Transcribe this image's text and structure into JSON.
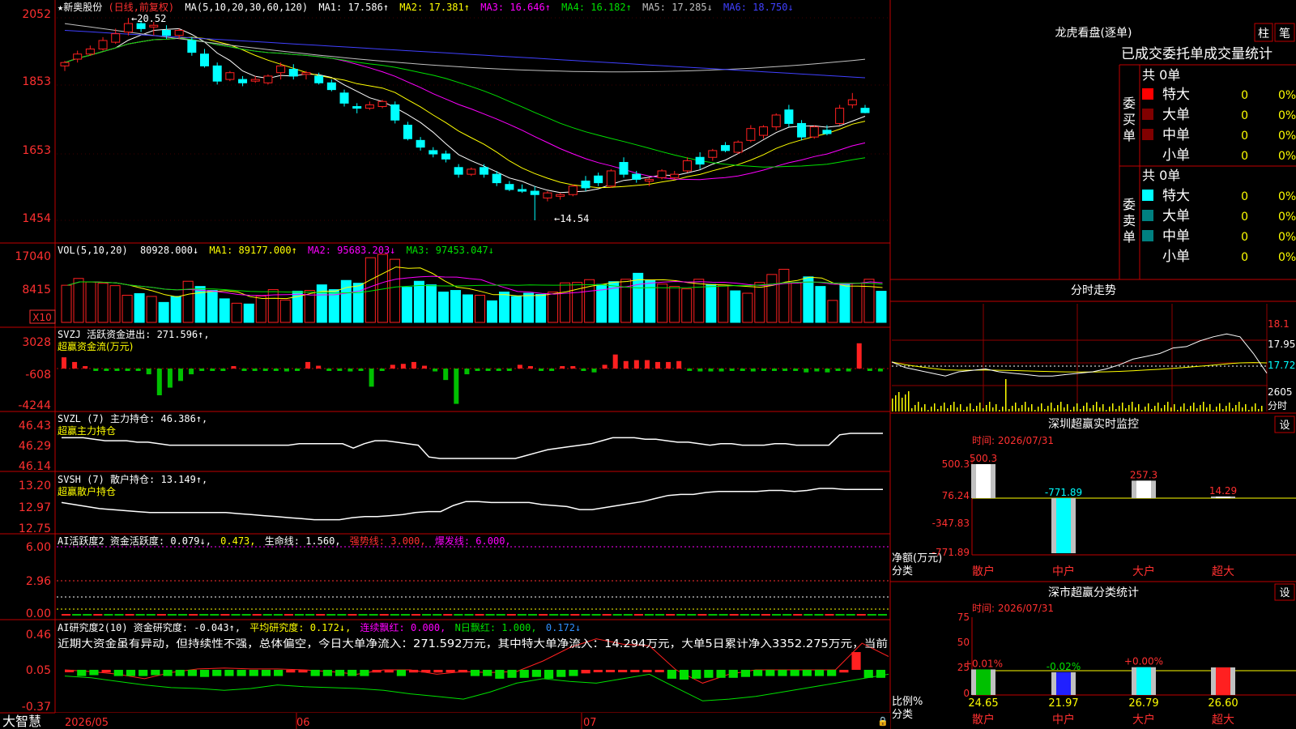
{
  "stock": {
    "name": "★新奥股份",
    "period": "(日线,前复权)",
    "hi_mark": "←20.52",
    "lo_mark": "←14.54"
  },
  "price_panel": {
    "ma_prefix": "MA(5,10,20,30,60,120)",
    "ma_items": [
      {
        "text": "MA1: 17.586↑",
        "color": "#ffffff"
      },
      {
        "text": "MA2: 17.381↑",
        "color": "#ffff00"
      },
      {
        "text": "MA3: 16.646↑",
        "color": "#ff00ff"
      },
      {
        "text": "MA4: 16.182↑",
        "color": "#00e000"
      },
      {
        "text": "MA5: 17.285↓",
        "color": "#c0c0c0"
      },
      {
        "text": "MA6: 18.750↓",
        "color": "#4040ff"
      }
    ],
    "ticks": [
      "2052",
      "1853",
      "1653",
      "1454"
    ]
  },
  "vol_panel": {
    "title": "VOL(5,10,20)",
    "items": [
      {
        "text": "80928.000↓",
        "color": "#ffffff"
      },
      {
        "text": "MA1: 89177.000↑",
        "color": "#ffff00"
      },
      {
        "text": "MA2: 95683.203↓",
        "color": "#ff00ff"
      },
      {
        "text": "MA3: 97453.047↓",
        "color": "#00e000"
      }
    ],
    "ticks": [
      "17040",
      "8415"
    ],
    "unit": "X10"
  },
  "svzj_panel": {
    "title": "SVZJ  活跃资金进出: 271.596↑,",
    "subtitle": "超赢资金流(万元)",
    "ticks": [
      "3028",
      "-608",
      "-4244"
    ]
  },
  "svzl_panel": {
    "title": "SVZL (7) 主力持仓: 46.386↑,",
    "subtitle": "超赢主力持仓",
    "ticks": [
      "46.43",
      "46.29",
      "46.14"
    ]
  },
  "svsh_panel": {
    "title": "SVSH (7) 散户持仓: 13.149↑,",
    "subtitle": "超赢散户持仓",
    "ticks": [
      "13.20",
      "12.97",
      "12.75"
    ]
  },
  "ai2_panel": {
    "items": [
      {
        "text": "AI活跃度2 资金活跃度: 0.079↓,",
        "color": "#ffffff"
      },
      {
        "text": "0.473,",
        "color": "#ffff00"
      },
      {
        "text": "生命线: 1.560,",
        "color": "#ffffff"
      },
      {
        "text": "强势线: 3.000,",
        "color": "#ff3030"
      },
      {
        "text": "爆发线: 6.000,",
        "color": "#ff00ff"
      }
    ],
    "ticks": [
      "6.00",
      "2.96",
      "0.00"
    ]
  },
  "ai_research_panel": {
    "items": [
      {
        "text": "AI研究度2(10) 资金研究度: -0.043↑,",
        "color": "#ffffff"
      },
      {
        "text": "平均研究度: 0.172↓,",
        "color": "#ffff00"
      },
      {
        "text": "连续飘红: 0.000,",
        "color": "#ff00ff"
      },
      {
        "text": "N日飘红: 1.000,",
        "color": "#00e000"
      },
      {
        "text": "0.172↓",
        "color": "#3090ff"
      }
    ],
    "comment": "近期大资金虽有异动，但持续性不强，总体偏空，今日大单净流入：271.592万元，其中特大单净流入：14.294万元，大单5日累计净入3352.275万元，当前",
    "ticks": [
      "0.46",
      "0.05",
      "-0.37"
    ]
  },
  "x_axis": {
    "labels": [
      "2026/05",
      "06",
      "07"
    ]
  },
  "footer": {
    "brand": "大智慧"
  },
  "lhb": {
    "title": "龙虎看盘(逐单)",
    "btn1": "柱",
    "btn2": "笔",
    "header": "已成交委托单成交量统计",
    "buy": {
      "label": "委买单",
      "total": "共 0单",
      "rows": [
        {
          "name": "特大",
          "count": "0",
          "pct": "0%",
          "color": "#ff0000"
        },
        {
          "name": "大单",
          "count": "0",
          "pct": "0%",
          "color": "#800000"
        },
        {
          "name": "中单",
          "count": "0",
          "pct": "0%",
          "color": "#800000"
        },
        {
          "name": "小单",
          "count": "0",
          "pct": "0%",
          "color": "#000000"
        }
      ]
    },
    "sell": {
      "label": "委卖单",
      "total": "共 0单",
      "rows": [
        {
          "name": "特大",
          "count": "0",
          "pct": "0%",
          "color": "#00ffff"
        },
        {
          "name": "大单",
          "count": "0",
          "pct": "0%",
          "color": "#008080"
        },
        {
          "name": "中单",
          "count": "0",
          "pct": "0%",
          "color": "#008080"
        },
        {
          "name": "小单",
          "count": "0",
          "pct": "0%",
          "color": "#000000"
        }
      ]
    }
  },
  "fenshi": {
    "title": "分时走势",
    "ticks": [
      "18.1",
      "17.95",
      "17.72",
      "2605"
    ],
    "unit": "分时"
  },
  "monitor": {
    "title": "深圳超赢实时监控",
    "btn": "设",
    "time": "时间: 2026/07/31",
    "yticks": [
      "500.3",
      "76.24",
      "-347.83",
      "-771.89"
    ],
    "ylabel": "净额(万元)",
    "xlabel": "分类",
    "bars": [
      {
        "cat": "散户",
        "value": 500.3,
        "label": "500.3"
      },
      {
        "cat": "中户",
        "value": -771.89,
        "label": "-771.89"
      },
      {
        "cat": "大户",
        "value": 257.3,
        "label": "257.3"
      },
      {
        "cat": "超大",
        "value": 14.29,
        "label": "14.29"
      }
    ]
  },
  "classify": {
    "title": "深市超赢分类统计",
    "btn": "设",
    "time": "时间: 2026/07/31",
    "yticks": [
      "75",
      "50",
      "25",
      "0"
    ],
    "ylabel": "比例%",
    "xlabel": "分类",
    "bars": [
      {
        "cat": "散户",
        "value": 24.65,
        "label": "24.65",
        "delta": "+0.01%",
        "color": "#00c000"
      },
      {
        "cat": "中户",
        "value": 21.97,
        "label": "21.97",
        "delta": "-0.02%",
        "color": "#2020ff"
      },
      {
        "cat": "大户",
        "value": 26.79,
        "label": "26.79",
        "delta": "+0.00%",
        "color": "#00ffff"
      },
      {
        "cat": "超大",
        "value": 26.6,
        "label": "26.60",
        "delta": "",
        "color": "#ff2020"
      }
    ]
  },
  "chart_data": [
    {
      "type": "candlestick",
      "title": "新奥股份 日线 前复权",
      "ylim": [
        14.54,
        20.52
      ],
      "ohlc": [
        [
          19.1,
          19.25,
          18.95,
          19.2
        ],
        [
          19.3,
          19.55,
          19.2,
          19.45
        ],
        [
          19.45,
          19.7,
          19.4,
          19.6
        ],
        [
          19.6,
          19.95,
          19.55,
          19.85
        ],
        [
          19.8,
          20.2,
          19.75,
          20.05
        ],
        [
          20.1,
          20.52,
          20.0,
          20.35
        ],
        [
          20.35,
          20.45,
          20.1,
          20.2
        ],
        [
          20.25,
          20.4,
          20.0,
          20.3
        ],
        [
          20.15,
          20.3,
          19.9,
          20.0
        ],
        [
          20.0,
          20.2,
          19.9,
          20.15
        ],
        [
          19.85,
          19.95,
          19.4,
          19.5
        ],
        [
          19.45,
          19.6,
          19.05,
          19.1
        ],
        [
          19.1,
          19.2,
          18.55,
          18.65
        ],
        [
          18.7,
          18.95,
          18.65,
          18.9
        ],
        [
          18.7,
          18.8,
          18.5,
          18.6
        ],
        [
          18.65,
          18.8,
          18.6,
          18.7
        ],
        [
          18.6,
          18.85,
          18.55,
          18.8
        ],
        [
          18.9,
          19.2,
          18.7,
          19.1
        ],
        [
          19.0,
          19.15,
          18.7,
          18.8
        ],
        [
          18.85,
          18.95,
          18.7,
          18.9
        ],
        [
          18.8,
          18.9,
          18.55,
          18.6
        ],
        [
          18.6,
          18.7,
          18.35,
          18.4
        ],
        [
          18.3,
          18.4,
          17.9,
          18.0
        ],
        [
          17.9,
          18.0,
          17.7,
          17.85
        ],
        [
          17.85,
          18.05,
          17.8,
          17.95
        ],
        [
          17.9,
          18.1,
          17.85,
          18.05
        ],
        [
          17.95,
          18.05,
          17.4,
          17.5
        ],
        [
          17.35,
          17.45,
          16.9,
          16.95
        ],
        [
          16.9,
          17.0,
          16.6,
          16.7
        ],
        [
          16.6,
          16.7,
          16.4,
          16.5
        ],
        [
          16.5,
          16.6,
          16.25,
          16.35
        ],
        [
          16.1,
          16.2,
          15.8,
          15.9
        ],
        [
          15.9,
          16.1,
          15.85,
          16.05
        ],
        [
          16.1,
          16.2,
          15.8,
          15.9
        ],
        [
          15.9,
          16.0,
          15.55,
          15.65
        ],
        [
          15.6,
          15.7,
          15.4,
          15.45
        ],
        [
          15.45,
          15.6,
          15.35,
          15.4
        ],
        [
          15.4,
          15.55,
          14.54,
          15.3
        ],
        [
          15.2,
          15.4,
          15.1,
          15.35
        ],
        [
          15.25,
          15.35,
          15.15,
          15.3
        ],
        [
          15.3,
          15.6,
          15.25,
          15.55
        ],
        [
          15.7,
          15.85,
          15.4,
          15.5
        ],
        [
          15.85,
          15.95,
          15.55,
          15.65
        ],
        [
          15.55,
          16.05,
          15.5,
          16.0
        ],
        [
          16.25,
          16.4,
          15.8,
          15.9
        ],
        [
          15.9,
          16.0,
          15.65,
          15.75
        ],
        [
          15.7,
          15.8,
          15.55,
          15.75
        ],
        [
          15.8,
          16.05,
          15.75,
          16.0
        ],
        [
          15.8,
          16.0,
          15.75,
          15.9
        ],
        [
          16.0,
          16.4,
          15.95,
          16.3
        ],
        [
          16.4,
          16.55,
          16.05,
          16.2
        ],
        [
          16.4,
          16.65,
          16.3,
          16.6
        ],
        [
          16.75,
          16.85,
          16.55,
          16.6
        ],
        [
          16.55,
          16.9,
          16.5,
          16.85
        ],
        [
          16.9,
          17.35,
          16.85,
          17.25
        ],
        [
          17.05,
          17.35,
          16.95,
          17.3
        ],
        [
          17.3,
          17.7,
          17.2,
          17.65
        ],
        [
          17.8,
          17.95,
          17.3,
          17.4
        ],
        [
          17.4,
          17.5,
          16.9,
          17.0
        ],
        [
          17.0,
          17.35,
          16.95,
          17.3
        ],
        [
          17.2,
          17.35,
          17.05,
          17.1
        ],
        [
          17.4,
          17.95,
          17.35,
          17.85
        ],
        [
          17.95,
          18.3,
          17.85,
          18.1
        ],
        [
          17.85,
          17.95,
          17.7,
          17.72
        ]
      ]
    },
    {
      "type": "bar",
      "title": "VOL(5,10,20)",
      "unit": "X10",
      "ylim": [
        0,
        17040
      ],
      "values": [
        9300,
        11000,
        10100,
        9800,
        9200,
        6800,
        7200,
        6500,
        5000,
        6500,
        10300,
        9000,
        8000,
        5900,
        4800,
        4600,
        6600,
        8200,
        5600,
        7800,
        8000,
        9400,
        8200,
        10500,
        9800,
        16200,
        17040,
        15800,
        8800,
        10300,
        9400,
        7600,
        8000,
        6900,
        6800,
        5400,
        7600,
        6500,
        7300,
        7000,
        7600,
        9900,
        10000,
        10700,
        9500,
        10200,
        10800,
        12300,
        10500,
        9600,
        9000,
        8400,
        10800,
        9500,
        9300,
        7900,
        7300,
        10000,
        12000,
        13300,
        9900,
        11400,
        9000,
        5500,
        9700,
        9800,
        10800,
        7800
      ]
    },
    {
      "type": "bar",
      "title": "SVZJ 超赢资金流(万元)",
      "ylim": [
        -4244,
        3028
      ],
      "values": [
        1200,
        700,
        200,
        -200,
        -100,
        -100,
        -200,
        -100,
        -600,
        -2800,
        -2000,
        -1300,
        -600,
        -200,
        -100,
        -100,
        0,
        -200,
        -100,
        -100,
        -200,
        -300,
        -100,
        700,
        300,
        -200,
        -100,
        -300,
        -100,
        -1900,
        -200,
        400,
        500,
        700,
        300,
        -300,
        -1200,
        -3700,
        -600,
        -100,
        -200,
        -100,
        -100,
        400,
        200,
        -100,
        -100,
        200,
        100,
        -100,
        -400,
        400,
        1500,
        800,
        900,
        900,
        700,
        700,
        800,
        -200,
        -300,
        -300,
        -300,
        -200,
        -200,
        -300,
        -200,
        -200,
        -100,
        -100,
        -400,
        -300,
        -400,
        -200,
        -300,
        2700,
        -100,
        -300
      ]
    },
    {
      "type": "line",
      "title": "SVZL 超赢主力持仓",
      "ylim": [
        46.14,
        46.43
      ],
      "values": [
        46.34,
        46.34,
        46.34,
        46.33,
        46.32,
        46.32,
        46.32,
        46.31,
        46.31,
        46.3,
        46.29,
        46.29,
        46.29,
        46.29,
        46.29,
        46.29,
        46.29,
        46.29,
        46.29,
        46.29,
        46.29,
        46.29,
        46.3,
        46.3,
        46.3,
        46.3,
        46.3,
        46.27,
        46.3,
        46.32,
        46.32,
        46.31,
        46.3,
        46.29,
        46.21,
        46.2,
        46.2,
        46.2,
        46.2,
        46.2,
        46.2,
        46.2,
        46.2,
        46.22,
        46.24,
        46.26,
        46.27,
        46.28,
        46.29,
        46.3,
        46.32,
        46.34,
        46.34,
        46.34,
        46.33,
        46.33,
        46.32,
        46.31,
        46.31,
        46.3,
        46.29,
        46.3,
        46.3,
        46.29,
        46.29,
        46.29,
        46.3,
        46.3,
        46.29,
        46.29,
        46.29,
        46.29,
        46.36,
        46.37,
        46.37,
        46.37,
        46.37
      ]
    },
    {
      "type": "line",
      "title": "SVSH 超赢散户持仓",
      "ylim": [
        12.75,
        13.2
      ],
      "values": [
        13.02,
        13.0,
        12.98,
        12.96,
        12.95,
        12.94,
        12.93,
        12.92,
        12.92,
        12.92,
        12.92,
        12.92,
        12.92,
        12.92,
        12.91,
        12.9,
        12.89,
        12.88,
        12.87,
        12.86,
        12.85,
        12.85,
        12.85,
        12.87,
        12.88,
        12.88,
        12.89,
        12.9,
        12.92,
        12.93,
        12.93,
        12.99,
        13.03,
        13.03,
        13.02,
        13.02,
        13.02,
        13.02,
        13.0,
        12.99,
        12.98,
        12.95,
        12.95,
        12.97,
        12.99,
        13.01,
        13.03,
        13.06,
        13.09,
        13.1,
        13.1,
        13.12,
        13.13,
        13.13,
        13.13,
        13.13,
        13.14,
        13.14,
        13.13,
        13.14,
        13.16,
        13.16,
        13.15,
        13.15,
        13.15,
        13.15
      ]
    },
    {
      "type": "bar",
      "title": "AI活跃度2",
      "ylim": [
        0,
        6
      ],
      "values": [
        0.05,
        0.05,
        0.05,
        0.05,
        0.05,
        0.05,
        0.05,
        0.05,
        0.05,
        0.05,
        0.05,
        0.05,
        0.05,
        0.05,
        0.05,
        0.05,
        0.05,
        0.05,
        0.05,
        0.05,
        0.05,
        0.05,
        0.05,
        0.05,
        0.05,
        0.05,
        0.05,
        0.05,
        0.05,
        0.05,
        0.05,
        0.05,
        0.05,
        0.05,
        0.05,
        0.05,
        0.05,
        0.05,
        0.05,
        0.05,
        0.05,
        0.05,
        0.05,
        0.05,
        0.05,
        0.05,
        0.05,
        0.05,
        0.05,
        0.05,
        0.05,
        0.05,
        0.05,
        0.05,
        0.05,
        0.05,
        0.05,
        0.05,
        0.05,
        0.05,
        0.05,
        0.05,
        0.05,
        0.05,
        0.05,
        0.05,
        0.05,
        0.05,
        0.05,
        0.05,
        0.05,
        0.05,
        0.05,
        0.05,
        0.05,
        0.079,
        0.05,
        0.05
      ]
    },
    {
      "type": "bar",
      "title": "AI研究度2(10)",
      "ylim": [
        -0.37,
        0.46
      ],
      "values": [
        0.05,
        -0.02,
        -0.01,
        0.02,
        -0.02,
        -0.02,
        -0.02,
        -0.01,
        -0.02,
        -0.02,
        -0.02,
        -0.03,
        -0.02,
        -0.02,
        -0.02,
        -0.02,
        -0.02,
        -0.02,
        0.02,
        0.02,
        -0.02,
        -0.02,
        -0.02,
        -0.02,
        -0.02,
        0.02,
        0.02,
        -0.02,
        0.02,
        0.02,
        0.02,
        0.02,
        0.02,
        -0.02,
        -0.02,
        -0.05,
        -0.04,
        -0.04,
        -0.03,
        -0.05,
        -0.03,
        -0.02,
        0.01,
        0.03,
        0.04,
        0.05,
        0.04,
        0.04,
        0.04,
        -0.05,
        -0.06,
        -0.05,
        -0.04,
        -0.04,
        -0.04,
        -0.03,
        -0.02,
        -0.02,
        -0.02,
        -0.02,
        -0.02,
        -0.02,
        -0.02,
        0.02,
        0.25,
        -0.04,
        -0.04
      ]
    },
    {
      "type": "line",
      "title": "分时走势",
      "ylim": [
        17.72,
        18.19
      ],
      "values": [
        17.8,
        17.76,
        17.74,
        17.72,
        17.7,
        17.73,
        17.74,
        17.75,
        17.73,
        17.72,
        17.71,
        17.7,
        17.7,
        17.71,
        17.72,
        17.73,
        17.75,
        17.78,
        17.82,
        17.84,
        17.86,
        17.9,
        17.91,
        17.95,
        17.98,
        18.0,
        17.98,
        17.86,
        17.72
      ]
    },
    {
      "type": "bar",
      "title": "深圳超赢实时监控",
      "categories": [
        "散户",
        "中户",
        "大户",
        "超大"
      ],
      "values": [
        500.3,
        -771.89,
        257.3,
        14.29
      ],
      "ylim": [
        -771.89,
        500.3
      ]
    },
    {
      "type": "bar",
      "title": "深市超赢分类统计",
      "categories": [
        "散户",
        "中户",
        "大户",
        "超大"
      ],
      "values": [
        24.65,
        21.97,
        26.79,
        26.6
      ],
      "ylim": [
        0,
        75
      ]
    }
  ]
}
